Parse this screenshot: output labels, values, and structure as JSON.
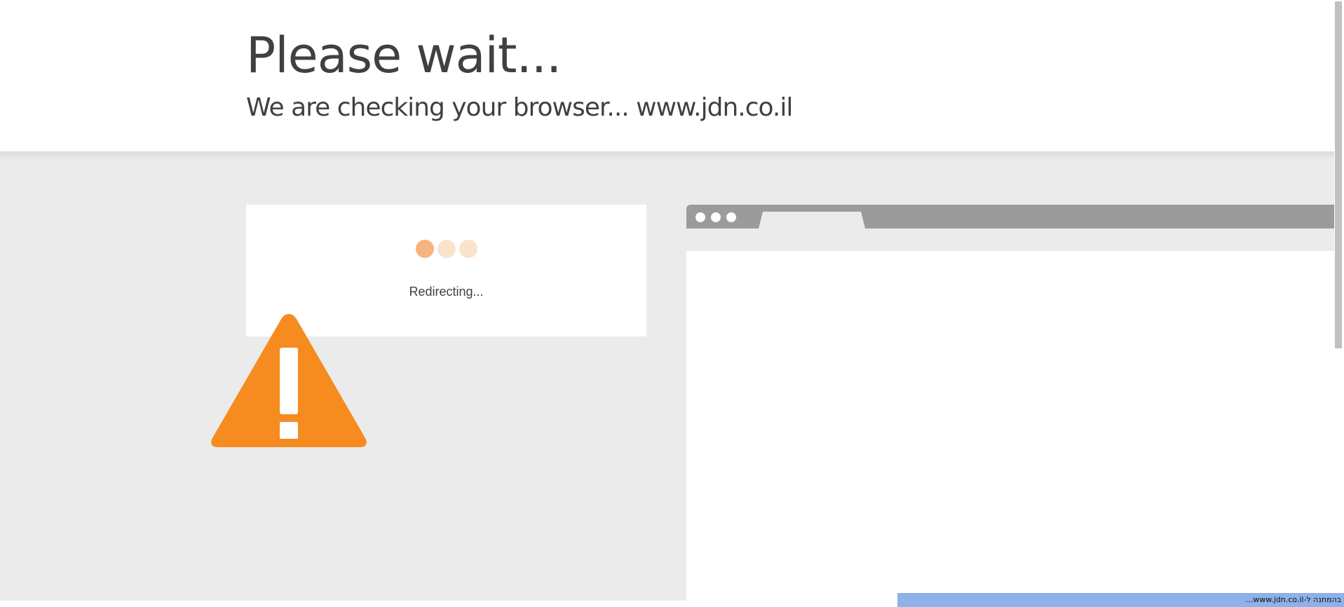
{
  "header": {
    "title": "Please wait...",
    "subtitle": "We are checking your browser... www.jdn.co.il"
  },
  "status_card": {
    "text": "Redirecting..."
  },
  "browser_illustration": {
    "icon": "warning-icon"
  },
  "statusbar": {
    "text": "בהמתנה ל-www.jdn.co.il..."
  },
  "colors": {
    "accent": "#f68b1f",
    "dot_active": "#f7b380",
    "dot_inactive": "#fbe2cc",
    "background": "#ebebeb"
  }
}
